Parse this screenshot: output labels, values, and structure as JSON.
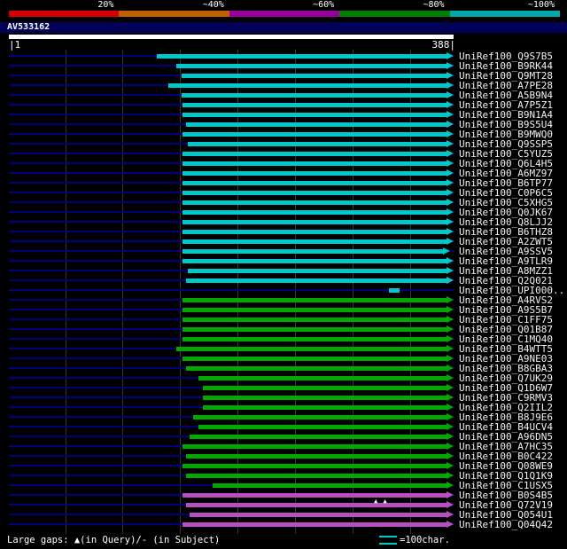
{
  "header": {
    "scale_labels": [
      "20%",
      "~40%",
      "~60%",
      "~80%",
      "~100%"
    ],
    "scale_colors": [
      "#d40000",
      "#c06000",
      "#9c009c",
      "#008000",
      "#00a8a8"
    ]
  },
  "query": {
    "name": "AV533162",
    "ruler_left": "|1",
    "ruler_right": "388|"
  },
  "chart_data": {
    "type": "bar",
    "orientation": "horizontal",
    "x_range": [
      1,
      388
    ],
    "gridline_interval": 50,
    "palette": {
      "cyan": "#00c8c8",
      "green": "#00a800",
      "magenta": "#b84fc0"
    },
    "hits": [
      {
        "label": "UniRef100_Q9S7B5",
        "color": "cyan",
        "start": 130,
        "end": 388
      },
      {
        "label": "UniRef100_B9RK44",
        "color": "cyan",
        "start": 147,
        "end": 388
      },
      {
        "label": "UniRef100_Q9MT28",
        "color": "cyan",
        "start": 151,
        "end": 388
      },
      {
        "label": "UniRef100_A7PE28",
        "color": "cyan",
        "start": 140,
        "end": 388
      },
      {
        "label": "UniRef100_A5B9N4",
        "color": "cyan",
        "start": 151,
        "end": 388
      },
      {
        "label": "UniRef100_A7P5Z1",
        "color": "cyan",
        "start": 152,
        "end": 388
      },
      {
        "label": "UniRef100_B9N1A4",
        "color": "cyan",
        "start": 152,
        "end": 388
      },
      {
        "label": "UniRef100_B9S5U4",
        "color": "cyan",
        "start": 155,
        "end": 388
      },
      {
        "label": "UniRef100_B9MWQ0",
        "color": "cyan",
        "start": 152,
        "end": 388
      },
      {
        "label": "UniRef100_Q9SSP5",
        "color": "cyan",
        "start": 157,
        "end": 388
      },
      {
        "label": "UniRef100_C5YUZ5",
        "color": "cyan",
        "start": 152,
        "end": 388
      },
      {
        "label": "UniRef100_Q6L4H5",
        "color": "cyan",
        "start": 152,
        "end": 388
      },
      {
        "label": "UniRef100_A6MZ97",
        "color": "cyan",
        "start": 152,
        "end": 388
      },
      {
        "label": "UniRef100_B6TP77",
        "color": "cyan",
        "start": 152,
        "end": 388
      },
      {
        "label": "UniRef100_C0P6C5",
        "color": "cyan",
        "start": 152,
        "end": 388
      },
      {
        "label": "UniRef100_C5XHG5",
        "color": "cyan",
        "start": 152,
        "end": 388
      },
      {
        "label": "UniRef100_Q0JK67",
        "color": "cyan",
        "start": 152,
        "end": 388
      },
      {
        "label": "UniRef100_Q8LJJ2",
        "color": "cyan",
        "start": 152,
        "end": 388
      },
      {
        "label": "UniRef100_B6THZ8",
        "color": "cyan",
        "start": 152,
        "end": 388
      },
      {
        "label": "UniRef100_A2ZWT5",
        "color": "cyan",
        "start": 152,
        "end": 388
      },
      {
        "label": "UniRef100_A9SSV5",
        "color": "cyan",
        "start": 152,
        "end": 385
      },
      {
        "label": "UniRef100_A9TLR9",
        "color": "cyan",
        "start": 152,
        "end": 388
      },
      {
        "label": "UniRef100_A8MZZ1",
        "color": "cyan",
        "start": 157,
        "end": 388
      },
      {
        "label": "UniRef100_Q2Q021",
        "color": "cyan",
        "start": 155,
        "end": 388
      },
      {
        "label": "UniRef100_UPI000..",
        "color": "cyan",
        "start": 332,
        "end": 341,
        "arrow": false
      },
      {
        "label": "UniRef100_A4RVS2",
        "color": "green",
        "start": 152,
        "end": 388
      },
      {
        "label": "UniRef100_A9S5B7",
        "color": "green",
        "start": 152,
        "end": 388
      },
      {
        "label": "UniRef100_C1FF75",
        "color": "green",
        "start": 152,
        "end": 388
      },
      {
        "label": "UniRef100_Q01B87",
        "color": "green",
        "start": 152,
        "end": 388
      },
      {
        "label": "UniRef100_C1MQ40",
        "color": "green",
        "start": 152,
        "end": 388
      },
      {
        "label": "UniRef100_B4WTT5",
        "color": "green",
        "start": 147,
        "end": 388
      },
      {
        "label": "UniRef100_A9NE03",
        "color": "green",
        "start": 152,
        "end": 388
      },
      {
        "label": "UniRef100_B8GBA3",
        "color": "green",
        "start": 155,
        "end": 388
      },
      {
        "label": "UniRef100_Q7UK29",
        "color": "green",
        "start": 166,
        "end": 388
      },
      {
        "label": "UniRef100_Q1D6W7",
        "color": "green",
        "start": 170,
        "end": 388
      },
      {
        "label": "UniRef100_C9RMV3",
        "color": "green",
        "start": 170,
        "end": 388
      },
      {
        "label": "UniRef100_Q2IIL2",
        "color": "green",
        "start": 170,
        "end": 388
      },
      {
        "label": "UniRef100_B8J9E6",
        "color": "green",
        "start": 161,
        "end": 388
      },
      {
        "label": "UniRef100_B4UCV4",
        "color": "green",
        "start": 166,
        "end": 388
      },
      {
        "label": "UniRef100_A96DN5",
        "color": "green",
        "start": 158,
        "end": 388
      },
      {
        "label": "UniRef100_A7HC35",
        "color": "green",
        "start": 152,
        "end": 388
      },
      {
        "label": "UniRef100_B0C422",
        "color": "green",
        "start": 155,
        "end": 388
      },
      {
        "label": "UniRef100_Q08WE9",
        "color": "green",
        "start": 152,
        "end": 388
      },
      {
        "label": "UniRef100_Q1Q1K9",
        "color": "green",
        "start": 155,
        "end": 388
      },
      {
        "label": "UniRef100_C1USX5",
        "color": "green",
        "start": 178,
        "end": 388
      },
      {
        "label": "UniRef100_B0S4B5",
        "color": "magenta",
        "start": 152,
        "end": 388
      },
      {
        "label": "UniRef100_Q72V19",
        "color": "magenta",
        "start": 155,
        "end": 388,
        "gap_markers": [
          321,
          329
        ]
      },
      {
        "label": "UniRef100_Q054U1",
        "color": "magenta",
        "start": 158,
        "end": 388
      },
      {
        "label": "UniRef100_Q04Q42",
        "color": "magenta",
        "start": 152,
        "end": 388
      }
    ]
  },
  "footer": {
    "gaps_legend": "Large gaps: ▲(in Query)/- (in Subject)",
    "scale_legend": "=100char."
  }
}
